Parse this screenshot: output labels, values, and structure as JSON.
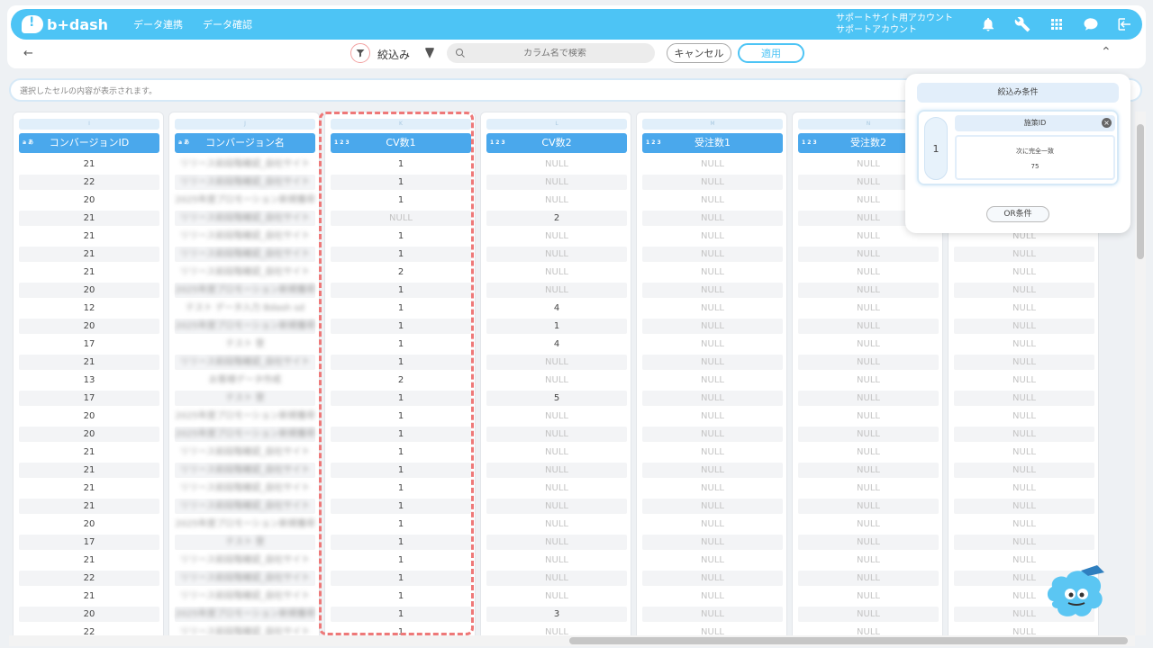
{
  "app": {
    "logo_text": "b+dash"
  },
  "nav": [
    "データ連携",
    "データ確認"
  ],
  "account": {
    "line1": "サポートサイト用アカウント",
    "line2": "サポートアカウント"
  },
  "toolbar": {
    "back": "←",
    "filter_label": "絞込み",
    "search_placeholder": "カラム名で検索",
    "cancel_label": "キャンセル",
    "apply_label": "適用",
    "collapse": "^"
  },
  "cell_bar_text": "選択したセルの内容が表示されます。",
  "columns": [
    {
      "letter": "I",
      "type": "a あ",
      "name": "コンバージョンID",
      "cells": [
        "21",
        "22",
        "20",
        "21",
        "21",
        "21",
        "21",
        "20",
        "12",
        "20",
        "17",
        "21",
        "13",
        "17",
        "20",
        "20",
        "21",
        "21",
        "21",
        "21",
        "20",
        "17",
        "21",
        "22",
        "21",
        "20",
        "22"
      ]
    },
    {
      "letter": "J",
      "type": "a あ",
      "name": "コンバージョン名",
      "blurred": true,
      "cells": [
        "リリース前段階確認_自社サイト",
        "リリース前段階確認_自社サイト",
        "2025年度プロモーション新規獲得",
        "リリース前段階確認_自社サイト",
        "リリース前段階確認_自社サイト",
        "リリース前段階確認_自社サイト",
        "リリース前段階確認_自社サイト",
        "2025年度プロモーション新規獲得",
        "テスト データ入力 Bdash sd",
        "2025年度プロモーション新規獲得",
        "テスト 登",
        "リリース前段階確認_自社サイト",
        "お客様データ作成",
        "テスト 登",
        "2025年度プロモーション新規獲得",
        "2025年度プロモーション新規獲得",
        "リリース前段階確認_自社サイト",
        "リリース前段階確認_自社サイト",
        "リリース前段階確認_自社サイト",
        "リリース前段階確認_自社サイト",
        "2025年度プロモーション新規獲得",
        "テスト 登",
        "リリース前段階確認_自社サイト",
        "リリース前段階確認_自社サイト",
        "リリース前段階確認_自社サイト",
        "2025年度プロモーション新規獲得",
        "リリース前段階確認_自社サイト"
      ]
    },
    {
      "letter": "K",
      "type": "1 2 3",
      "name": "CV数1",
      "cells": [
        "1",
        "1",
        "1",
        "NULL",
        "1",
        "1",
        "2",
        "1",
        "1",
        "1",
        "1",
        "1",
        "2",
        "1",
        "1",
        "1",
        "1",
        "1",
        "1",
        "1",
        "1",
        "1",
        "1",
        "1",
        "1",
        "1",
        "1"
      ]
    },
    {
      "letter": "L",
      "type": "1 2 3",
      "name": "CV数2",
      "cells": [
        "NULL",
        "NULL",
        "NULL",
        "2",
        "NULL",
        "NULL",
        "NULL",
        "NULL",
        "4",
        "1",
        "4",
        "NULL",
        "NULL",
        "5",
        "NULL",
        "NULL",
        "NULL",
        "NULL",
        "NULL",
        "NULL",
        "NULL",
        "NULL",
        "NULL",
        "NULL",
        "NULL",
        "3",
        "NULL"
      ]
    },
    {
      "letter": "M",
      "type": "1 2 3",
      "name": "受注数1",
      "cells": [
        "NULL",
        "NULL",
        "NULL",
        "NULL",
        "NULL",
        "NULL",
        "NULL",
        "NULL",
        "NULL",
        "NULL",
        "NULL",
        "NULL",
        "NULL",
        "NULL",
        "NULL",
        "NULL",
        "NULL",
        "NULL",
        "NULL",
        "NULL",
        "NULL",
        "NULL",
        "NULL",
        "NULL",
        "NULL",
        "NULL",
        "NULL"
      ]
    },
    {
      "letter": "N",
      "type": "1 2 3",
      "name": "受注数2",
      "cells": [
        "NULL",
        "NULL",
        "NULL",
        "NULL",
        "NULL",
        "NULL",
        "NULL",
        "NULL",
        "NULL",
        "NULL",
        "NULL",
        "NULL",
        "NULL",
        "NULL",
        "NULL",
        "NULL",
        "NULL",
        "NULL",
        "NULL",
        "NULL",
        "NULL",
        "NULL",
        "NULL",
        "NULL",
        "NULL",
        "NULL",
        "NULL"
      ]
    },
    {
      "letter": "O",
      "type": "1 2 3",
      "name": "",
      "cells": [
        "NULL",
        "NULL",
        "NULL",
        "NULL",
        "NULL",
        "NULL",
        "NULL",
        "NULL",
        "NULL",
        "NULL",
        "NULL",
        "NULL",
        "NULL",
        "NULL",
        "NULL",
        "NULL",
        "NULL",
        "NULL",
        "NULL",
        "NULL",
        "NULL",
        "NULL",
        "NULL",
        "NULL",
        "NULL",
        "NULL",
        "NULL"
      ]
    }
  ],
  "filter_popup": {
    "title": "絞込み条件",
    "condition_number": "1",
    "condition_column": "施策ID",
    "condition_operator": "次に完全一致",
    "condition_value": "75",
    "or_button": "OR条件"
  },
  "colors": {
    "brand": "#4dc4f5",
    "header": "#4aa8ec",
    "highlight": "#ee7878"
  }
}
